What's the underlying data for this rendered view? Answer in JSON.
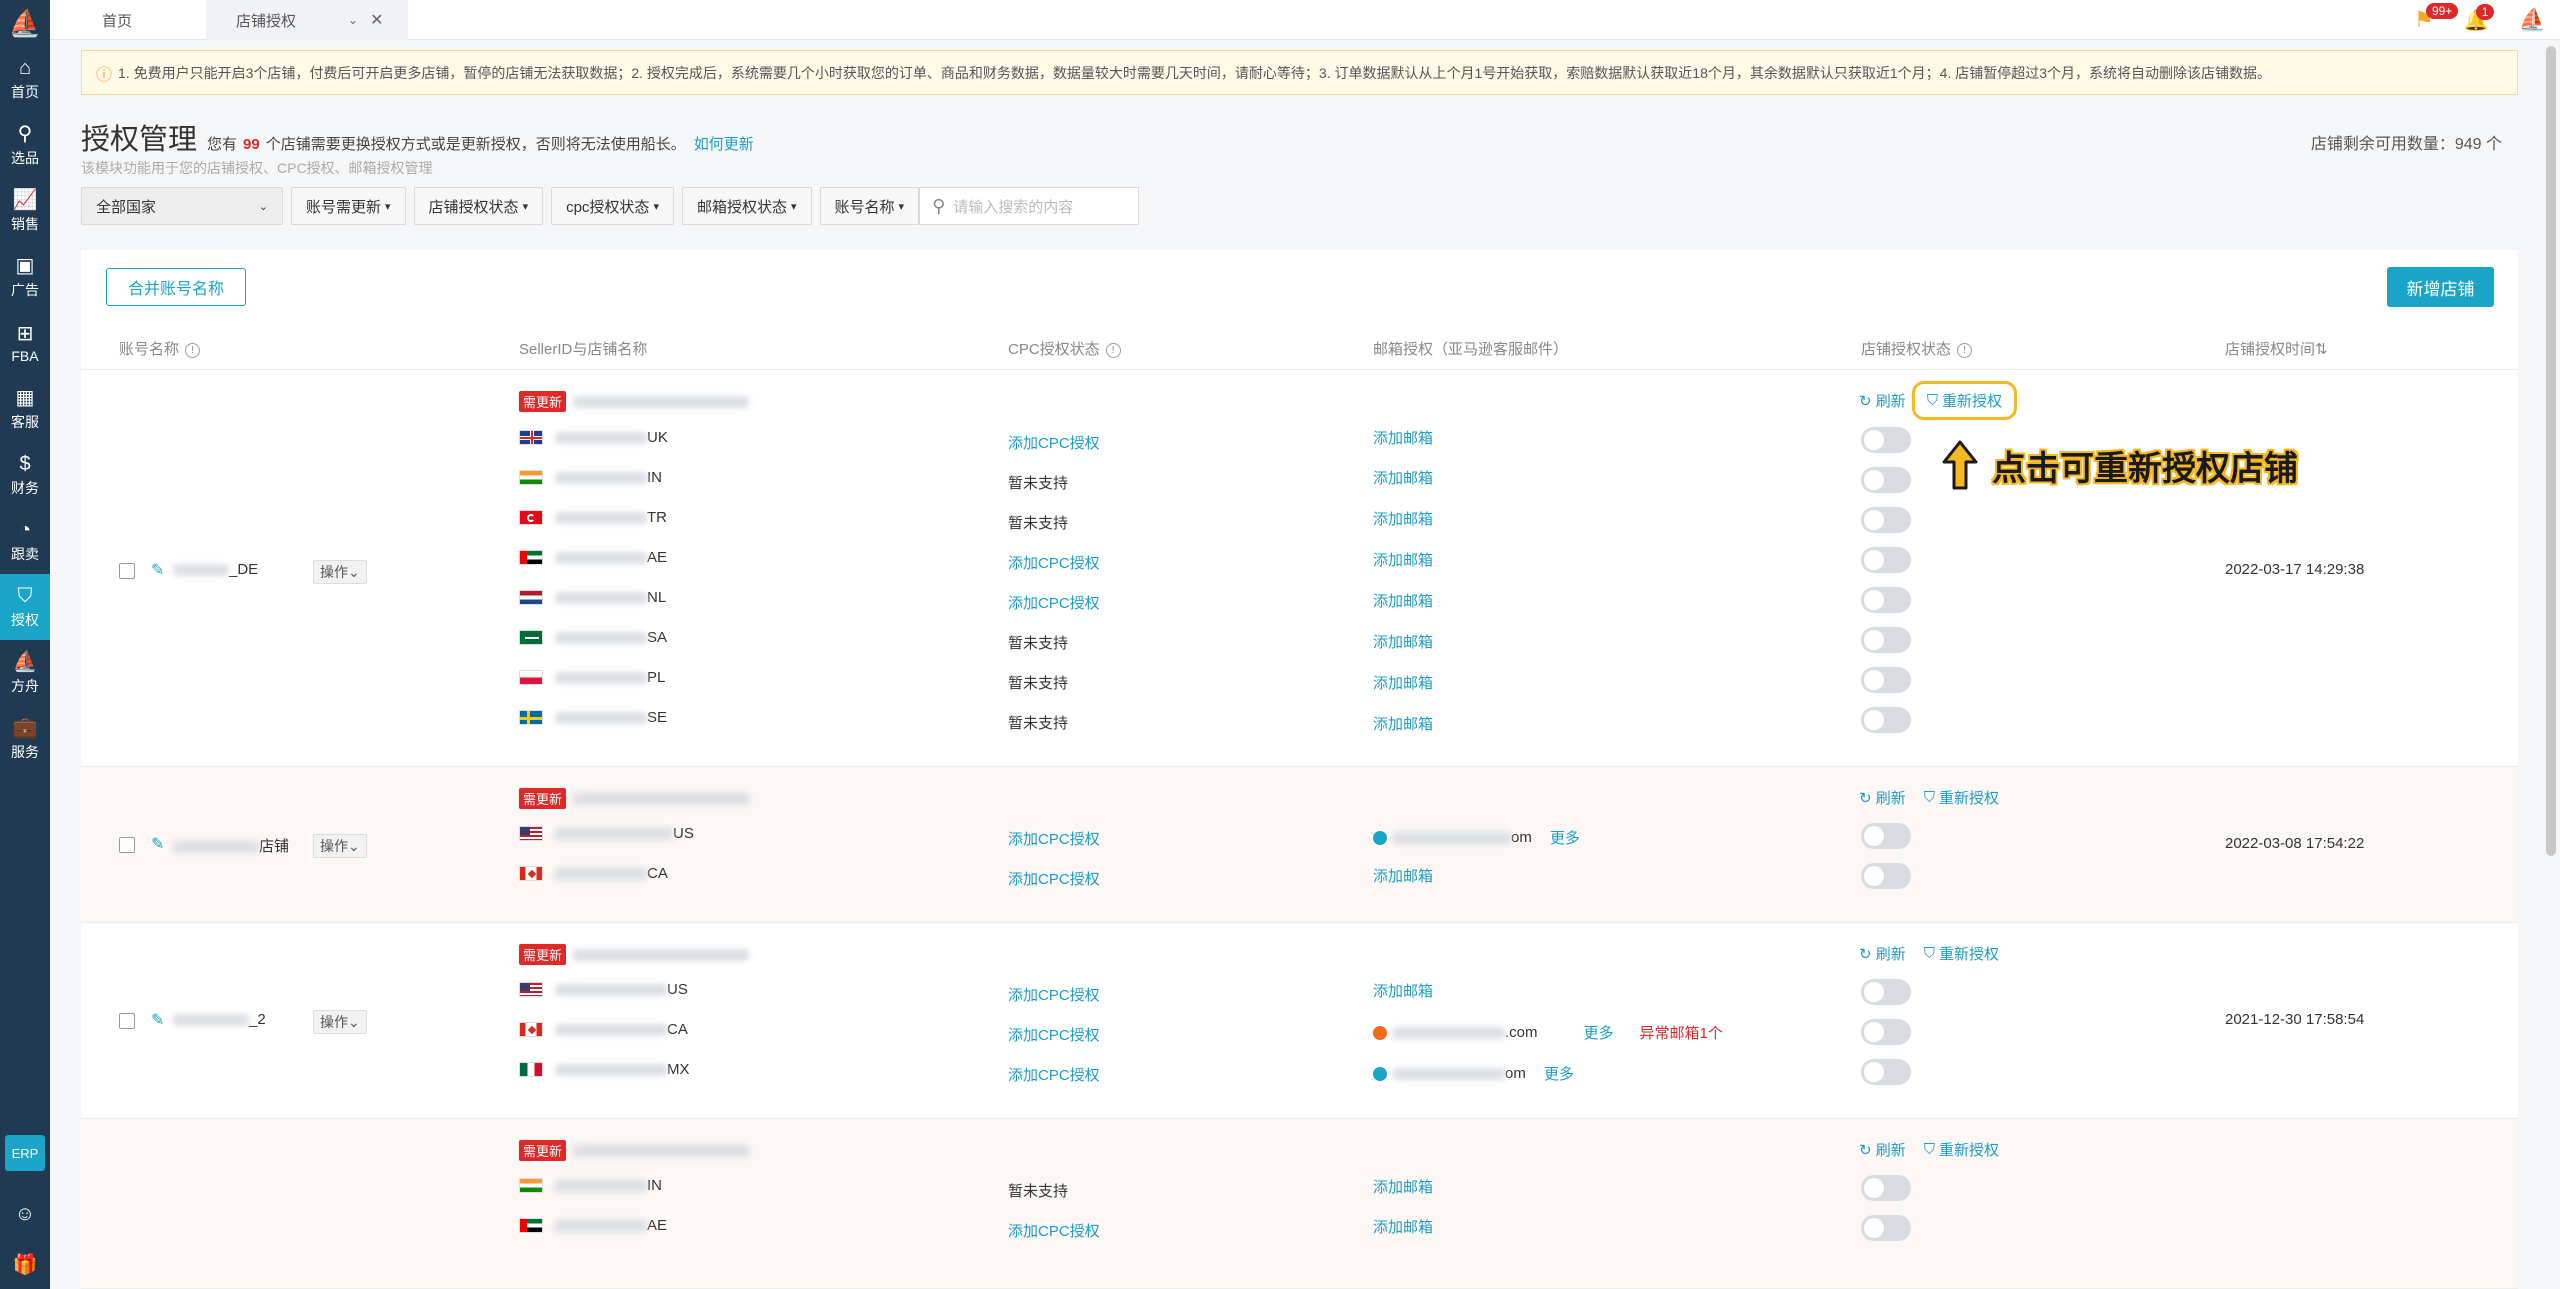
{
  "sidebar": {
    "items": [
      {
        "label": "首页",
        "icon": "home-icon"
      },
      {
        "label": "选品",
        "icon": "search-icon"
      },
      {
        "label": "销售",
        "icon": "chart-line-icon"
      },
      {
        "label": "广告",
        "icon": "ad-icon"
      },
      {
        "label": "FBA",
        "icon": "box-icon"
      },
      {
        "label": "客服",
        "icon": "service-icon"
      },
      {
        "label": "财务",
        "icon": "dollar-icon"
      },
      {
        "label": "跟卖",
        "icon": "pie-icon"
      },
      {
        "label": "授权",
        "icon": "shield-icon"
      },
      {
        "label": "方舟",
        "icon": "ark-icon"
      },
      {
        "label": "服务",
        "icon": "briefcase-icon"
      }
    ],
    "erp": "ERP"
  },
  "tabs": {
    "home": "首页",
    "auth": "店铺授权"
  },
  "header": {
    "flag_badge": "99+",
    "bell_badge": "1"
  },
  "notice": "1. 免费用户只能开启3个店铺，付费后可开启更多店铺，暂停的店铺无法获取数据；2. 授权完成后，系统需要几个小时获取您的订单、商品和财务数据，数据量较大时需要几天时间，请耐心等待；3. 订单数据默认从上个月1号开始获取，索赔数据默认获取近18个月，其余数据默认只获取近1个月；4. 店铺暂停超过3个月，系统将自动删除该店铺数据。",
  "page": {
    "title": "授权管理",
    "desc_pre": "您有",
    "desc_num": "99",
    "desc_post": "个店铺需要更换授权方式或是更新授权，否则将无法使用船长。",
    "desc_link": "如何更新",
    "subtitle": "该模块功能用于您的店铺授权、CPC授权、邮箱授权管理",
    "quota": "店铺剩余可用数量：949 个"
  },
  "filters": {
    "country": "全部国家",
    "need_update": "账号需更新",
    "shop_auth": "店铺授权状态",
    "cpc_auth": "cpc授权状态",
    "mail_auth": "邮箱授权状态",
    "acct_name": "账号名称",
    "search_placeholder": "请输入搜索的内容"
  },
  "buttons": {
    "merge": "合并账号名称",
    "add_shop": "新增店铺"
  },
  "columns": {
    "account": "账号名称",
    "seller": "SellerID与店铺名称",
    "cpc": "CPC授权状态",
    "mail": "邮箱授权（亚马逊客服邮件）",
    "shop": "店铺授权状态",
    "time": "店铺授权时间"
  },
  "common": {
    "need_update": "需更新",
    "ops": "操作",
    "refresh": "刷新",
    "reauth": "重新授权",
    "add_cpc": "添加CPC授权",
    "not_supported": "暂未支持",
    "add_mail": "添加邮箱",
    "more": "更多",
    "abnormal": "异常邮箱1个"
  },
  "groups": [
    {
      "account_suffix": "_DE",
      "time": "2022-03-17 14:29:38",
      "rows": [
        {
          "suffix": "UK",
          "flag": "uk",
          "cpc": "add"
        },
        {
          "suffix": "IN",
          "flag": "in",
          "cpc": "ns"
        },
        {
          "suffix": "TR",
          "flag": "tr",
          "cpc": "ns"
        },
        {
          "suffix": "AE",
          "flag": "ae",
          "cpc": "add"
        },
        {
          "suffix": "NL",
          "flag": "nl",
          "cpc": "add"
        },
        {
          "suffix": "SA",
          "flag": "sa",
          "cpc": "ns"
        },
        {
          "suffix": "PL",
          "flag": "pl",
          "cpc": "ns"
        },
        {
          "suffix": "SE",
          "flag": "se",
          "cpc": "ns"
        }
      ]
    },
    {
      "account_suffix": "店铺",
      "time": "2022-03-08 17:54:22",
      "rows": [
        {
          "suffix": "US",
          "flag": "us",
          "cpc": "add",
          "mail_suffix": "om"
        },
        {
          "suffix": "CA",
          "flag": "ca",
          "cpc": "add"
        }
      ]
    },
    {
      "account_suffix": "_2",
      "time": "2021-12-30 17:58:54",
      "rows": [
        {
          "suffix": "US",
          "flag": "us",
          "cpc": "add"
        },
        {
          "suffix": "CA",
          "flag": "ca",
          "cpc": "add",
          "mail_suffix": ".com"
        },
        {
          "suffix": "MX",
          "flag": "mx",
          "cpc": "add",
          "mail_suffix": "om"
        }
      ]
    },
    {
      "rows": [
        {
          "suffix": "IN",
          "flag": "in",
          "cpc": "ns"
        },
        {
          "suffix": "AE",
          "flag": "ae",
          "cpc": "add"
        }
      ]
    }
  ],
  "callout": "点击可重新授权店铺",
  "colors": {
    "accent": "#19a4c8",
    "sidebar": "#1f3a52",
    "danger": "#e02828",
    "highlight": "#f5b820"
  }
}
